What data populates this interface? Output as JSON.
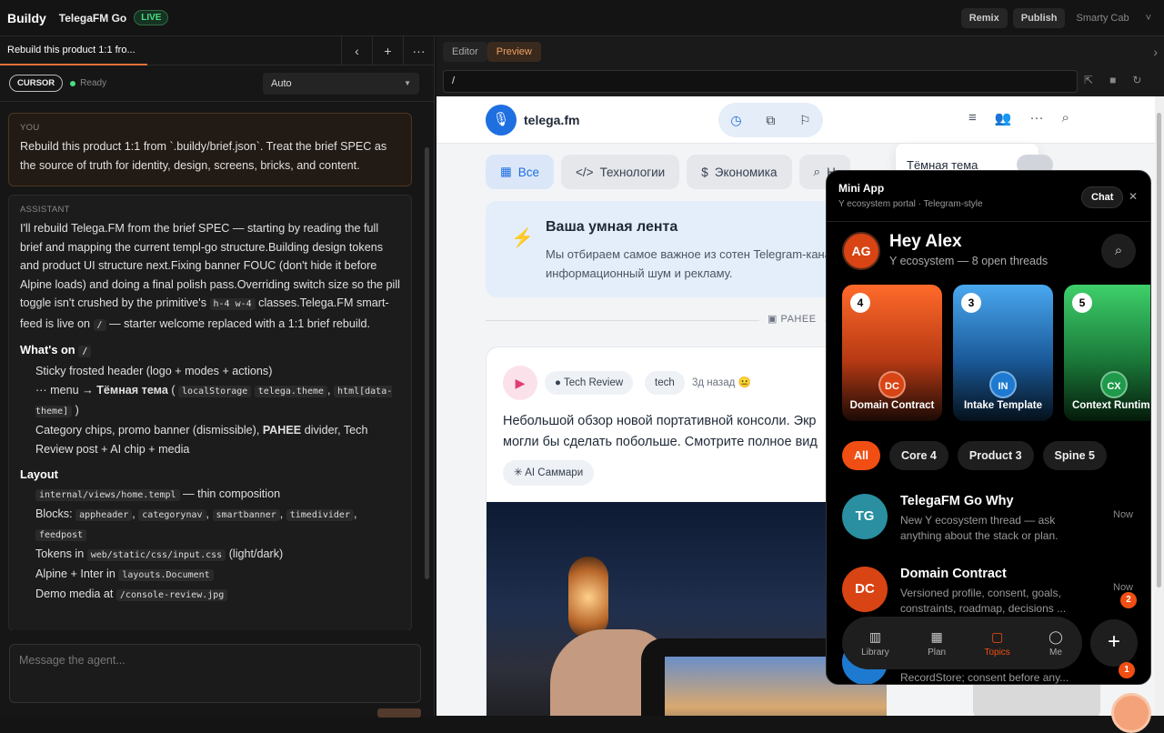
{
  "topbar": {
    "brand": "Buildy",
    "project": "TelegaFM Go",
    "live": "LIVE",
    "remix": "Remix",
    "publish": "Publish",
    "account": "Smarty Cab"
  },
  "left": {
    "tab": "Rebuild this product 1:1 fro...",
    "cursor": "CURSOR",
    "status": "Ready",
    "mode": "Auto",
    "you_label": "YOU",
    "you_text": "Rebuild this product 1:1 from `.buildy/brief.json`. Treat the brief SPEC as the source of truth for identity, design, screens, bricks, and content.",
    "assistant_label": "ASSISTANT",
    "assistant_p1": "I'll rebuild Telega.FM from the brief SPEC — starting by reading the full brief and mapping the current templ-go structure.Building design tokens and product UI structure next.Fixing banner FOUC (don't hide it before Alpine loads) and doing a final polish pass.Overriding switch size so the pill toggle isn't crushed by the primitive's",
    "code_hw": "h-4 w-4",
    "assistant_p1b": "classes.Telega.FM smart-feed is live on",
    "code_slash": "/",
    "assistant_p1c": "— starter welcome replaced with a 1:1 brief rebuild.",
    "h_whats": "What's on",
    "li1": "Sticky frosted header (logo + modes + actions)",
    "li2a": "··· menu →",
    "li2b": "Тёмная тема",
    "code_ls": "localStorage",
    "code_tt": "telega.theme",
    "code_html": "html[data-theme]",
    "li3a": "Category chips, promo banner (dismissible),",
    "li3b": "РАНЕЕ",
    "li3c": "divider, Tech Review post + AI chip + media",
    "h_layout": "Layout",
    "code_home": "internal/views/home.templ",
    "li4": "— thin composition",
    "li5": "Blocks:",
    "code_b1": "appheader",
    "code_b2": "categorynav",
    "code_b3": "smartbanner",
    "code_b4": "timedivider",
    "code_b5": "feedpost",
    "li6": "Tokens in",
    "code_css": "web/static/css/input.css",
    "li6b": "(light/dark)",
    "li7": "Alpine + Inter in",
    "code_doc": "layouts.Document",
    "li8": "Demo media at",
    "code_jpg": "/console-review.jpg",
    "input_placeholder": "Message the agent..."
  },
  "right": {
    "tab_editor": "Editor",
    "tab_preview": "Preview",
    "url": "/",
    "app": {
      "logo_text": "telega.fm",
      "chips": [
        "Все",
        "Технологии",
        "Экономика",
        "Н"
      ],
      "theme_item": "Тёмная тема",
      "banner_title": "Ваша умная лента",
      "banner_text": "Мы отбираем самое важное из сотен Telegram-каналов на информационный шум и рекламу.",
      "divider": "РАНЕЕ",
      "post": {
        "tag1": "Tech Review",
        "tag2": "tech",
        "time": "3д назад",
        "emoji": "😐",
        "body1": "Небольшой обзор новой портативной консоли. Экр",
        "body2": "могли бы сделать побольше. Смотрите полное вид",
        "ai": "AI Саммари"
      }
    },
    "mini": {
      "title": "Mini App",
      "subtitle": "Y ecosystem portal · Telegram-style",
      "chat": "Chat",
      "avatar": "AG",
      "greeting": "Hey Alex",
      "summary": "Y ecosystem — 8 open threads",
      "cards": [
        {
          "num": "4",
          "initials": "DC",
          "label": "Domain Contract"
        },
        {
          "num": "3",
          "initials": "IN",
          "label": "Intake Template"
        },
        {
          "num": "5",
          "initials": "CX",
          "label": "Context Runtime"
        }
      ],
      "filters": [
        "All",
        "Core 4",
        "Product 3",
        "Spine 5"
      ],
      "threads": [
        {
          "initials": "TG",
          "title": "TelegaFM Go Why",
          "text": "New Y ecosystem thread — ask anything about the stack or plan.",
          "time": "Now"
        },
        {
          "initials": "DC",
          "title": "Domain Contract",
          "text": "Versioned profile, consent, goals, constraints, roadmap, decisions ...",
          "time": "Now",
          "badge": "2"
        },
        {
          "text": "RecordStore; consent before any..."
        }
      ],
      "nav": [
        {
          "label": "Library",
          "icon": "▥"
        },
        {
          "label": "Plan",
          "icon": "▦"
        },
        {
          "label": "Topics",
          "icon": "▢"
        },
        {
          "label": "Me",
          "icon": "◯"
        }
      ],
      "fab": "+",
      "fab_badge": "1"
    }
  }
}
